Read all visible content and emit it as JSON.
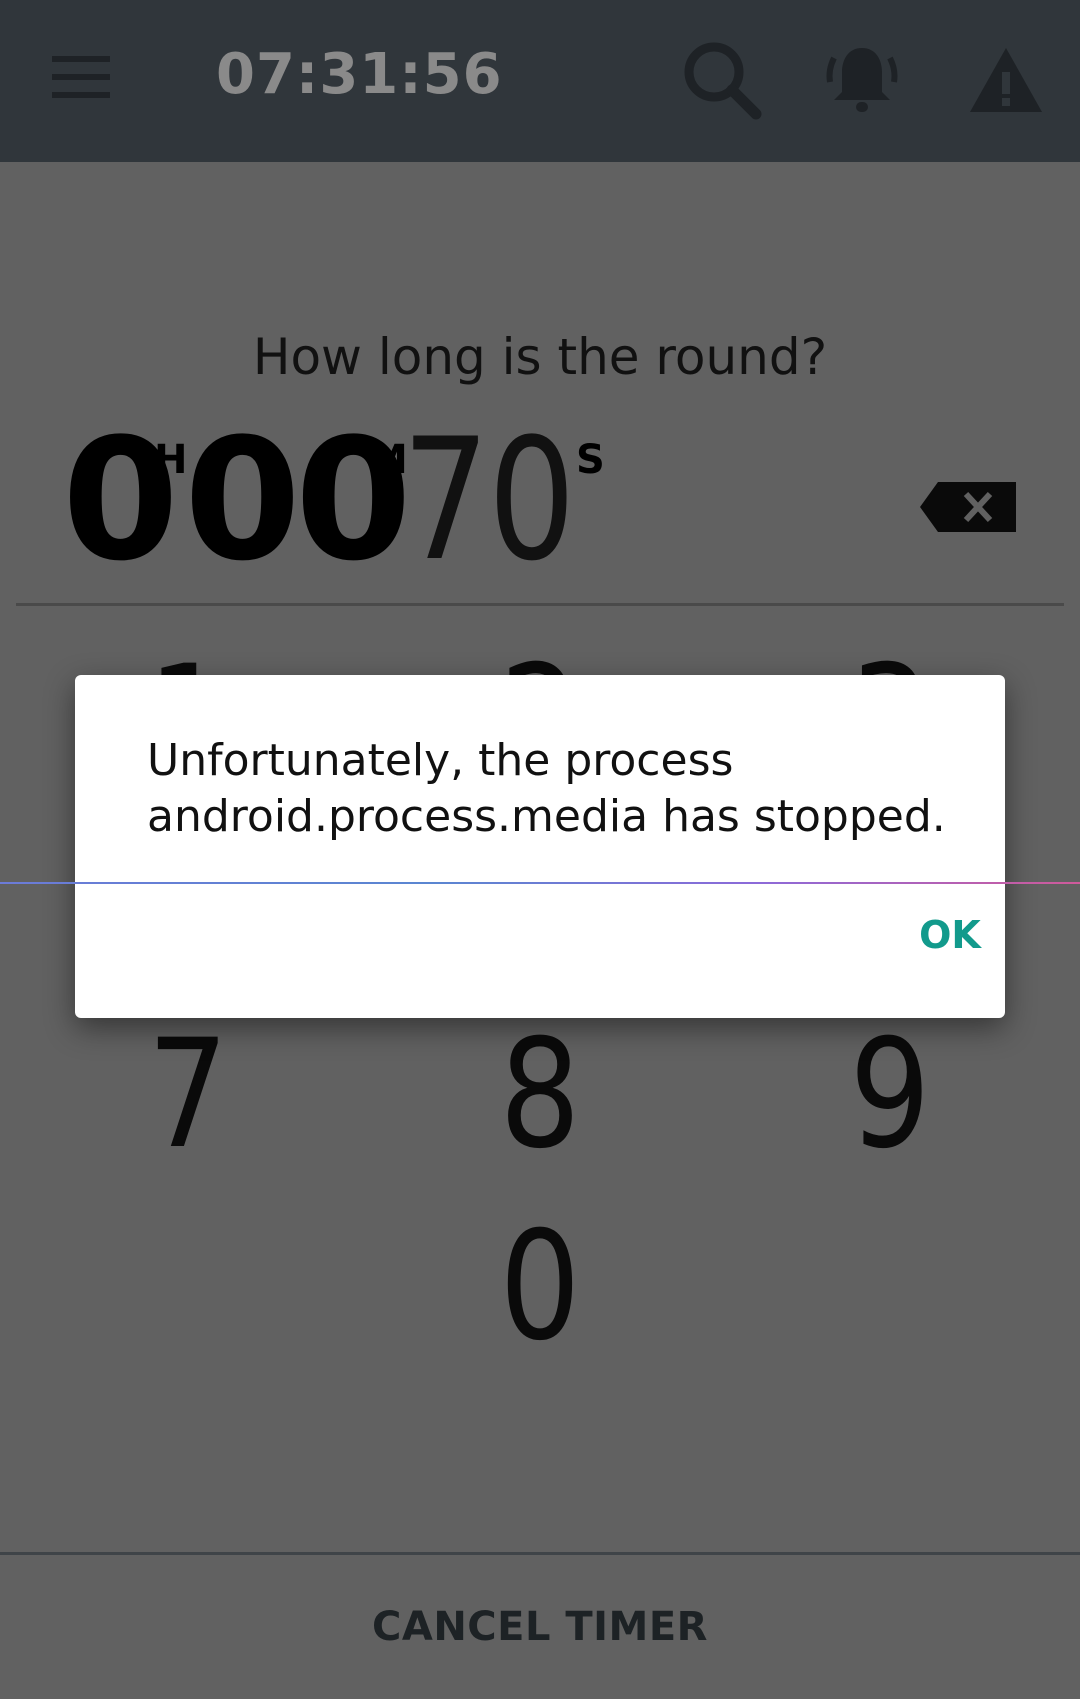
{
  "appbar": {
    "clock": "07:31:56",
    "icons": [
      "menu-icon",
      "search-icon",
      "bell-icon",
      "alert-icon"
    ]
  },
  "prompt": "How long is the round?",
  "timer": {
    "hours": "0",
    "hours_unit": "H",
    "minutes": "00",
    "minutes_unit": "M",
    "seconds": "70",
    "seconds_unit": "S"
  },
  "keypad": {
    "keys": [
      "1",
      "2",
      "3",
      "7",
      "8",
      "9",
      "0"
    ]
  },
  "dialog": {
    "message": "Unfortunately, the process android.process.media has stopped.",
    "ok_label": "OK"
  },
  "footer": {
    "cancel_label": "CANCEL TIMER"
  },
  "colors": {
    "appbar": "#30363b",
    "scrim_background": "#616161",
    "accent": "#129a8c"
  }
}
